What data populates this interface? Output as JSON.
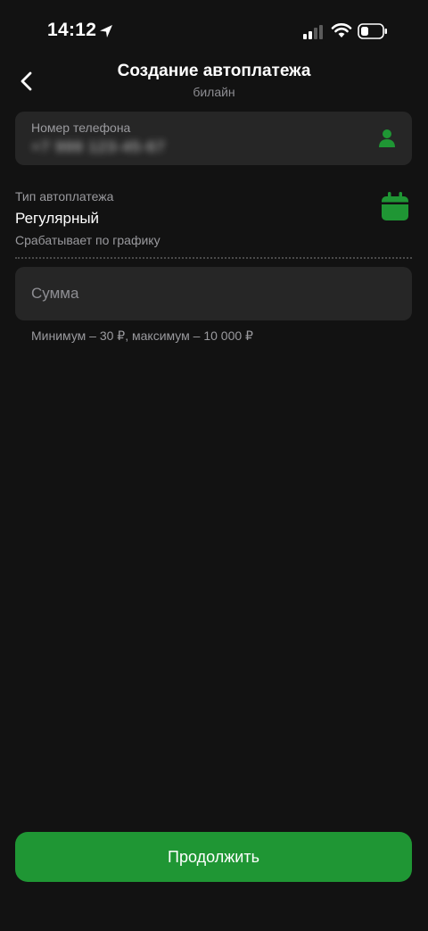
{
  "status_bar": {
    "time": "14:12",
    "icons": [
      "location-arrow-icon",
      "cellular-signal-icon",
      "wifi-icon",
      "battery-icon"
    ]
  },
  "header": {
    "title": "Создание автоплатежа",
    "subtitle": "билайн",
    "back_icon": "chevron-left-icon"
  },
  "phone": {
    "label": "Номер телефона",
    "value": "+7 999 123-45-67",
    "icon": "contact-person-icon"
  },
  "autopay_type": {
    "label": "Тип автоплатежа",
    "value": "Регулярный",
    "description": "Срабатывает по графику",
    "icon": "calendar-icon"
  },
  "amount": {
    "placeholder": "Сумма",
    "value": "",
    "hint": "Минимум – 30 ₽, максимум – 10 000 ₽"
  },
  "actions": {
    "continue_label": "Продолжить"
  },
  "colors": {
    "background": "#121212",
    "card": "#262626",
    "accent": "#1f9634",
    "secondary_text": "#9a9a9e"
  }
}
